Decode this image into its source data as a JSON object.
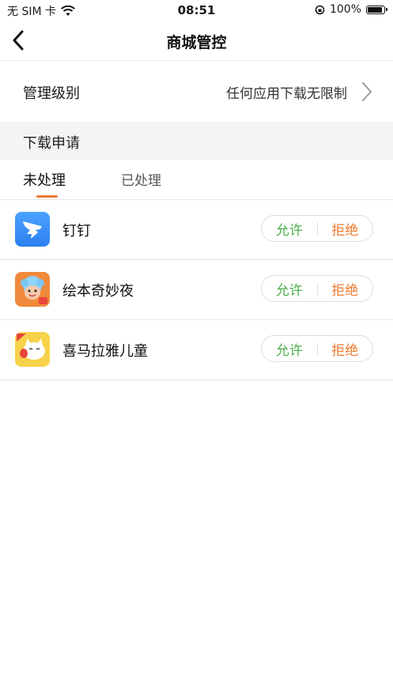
{
  "status_bar": {
    "carrier": "无 SIM 卡",
    "time": "08:51",
    "battery": "100%"
  },
  "nav": {
    "title": "商城管控"
  },
  "management": {
    "label": "管理级别",
    "value": "任何应用下载无限制"
  },
  "section": {
    "title": "下载申请"
  },
  "tabs": [
    {
      "label": "未处理",
      "active": true
    },
    {
      "label": "已处理",
      "active": false
    }
  ],
  "apps": [
    {
      "name": "钉钉",
      "icon": "dingtalk-icon",
      "allow": "允许",
      "reject": "拒绝"
    },
    {
      "name": "绘本奇妙夜",
      "icon": "picturebook-icon",
      "allow": "允许",
      "reject": "拒绝"
    },
    {
      "name": "喜马拉雅儿童",
      "icon": "ximalaya-kids-icon",
      "allow": "允许",
      "reject": "拒绝"
    }
  ],
  "colors": {
    "accent": "#ee7b30",
    "allow": "#4cae4c",
    "section_bg": "#f4f4f4"
  }
}
